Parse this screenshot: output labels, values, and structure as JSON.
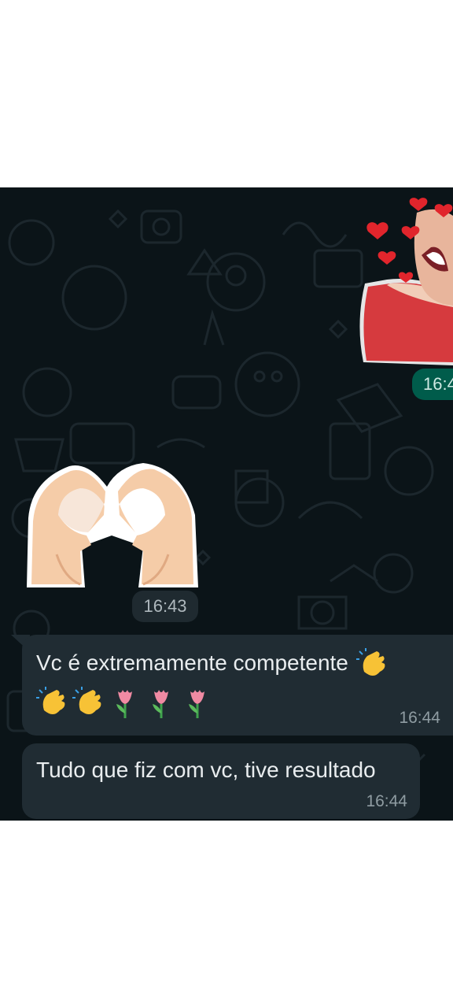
{
  "chat": {
    "outgoing_sticker": {
      "time": "16:4"
    },
    "incoming_sticker": {
      "time": "16:43"
    },
    "messages": [
      {
        "text": "Vc é extremamente competente",
        "emojis": [
          "clapping-hands",
          "clapping-hands",
          "clapping-hands",
          "tulip",
          "tulip",
          "tulip"
        ],
        "time": "16:44"
      },
      {
        "text": "Tudo que fiz com vc, tive resultado",
        "time": "16:44"
      }
    ]
  },
  "colors": {
    "chat_background": "#0b1418",
    "incoming_bubble": "#202c33",
    "outgoing_accent": "#005c4b",
    "message_text": "#e9edef",
    "timestamp_text": "#8f9ca2"
  }
}
